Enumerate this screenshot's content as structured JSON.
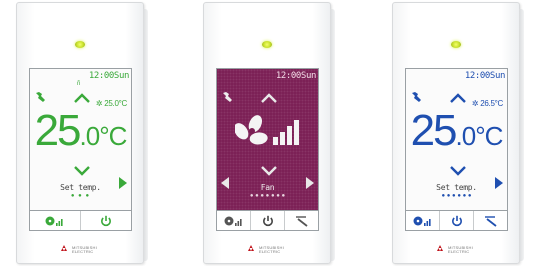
{
  "colors": {
    "green": "#3aa93a",
    "blue": "#1f4fb0",
    "purple_screen": "#7a1d53",
    "icon_dark": "#333333"
  },
  "brand": {
    "line1": "MITSUBISHI",
    "line2": "ELECTRIC"
  },
  "panels": [
    {
      "theme": "green",
      "time": "12:00Sun",
      "indicator": "ñ",
      "setpoint": "25.0°C",
      "temp_int": "25",
      "temp_frac": ".0",
      "temp_unit": "°C",
      "caption": "Set temp.",
      "dots": "● ● ●",
      "buttons": [
        "fan-speed",
        "power"
      ]
    },
    {
      "theme": "purple",
      "time": "12:00Sun",
      "caption": "Fan",
      "dots": "● ● ● ● ● ● ●",
      "buttons": [
        "fan-speed",
        "power",
        "vane"
      ]
    },
    {
      "theme": "blue",
      "time": "12:00Sun",
      "setpoint": "26.5°C",
      "temp_int": "25",
      "temp_frac": ".0",
      "temp_unit": "°C",
      "caption": "Set temp.",
      "dots": "● ● ● ● ● ●",
      "buttons": [
        "fan-speed",
        "power",
        "vane"
      ]
    }
  ]
}
